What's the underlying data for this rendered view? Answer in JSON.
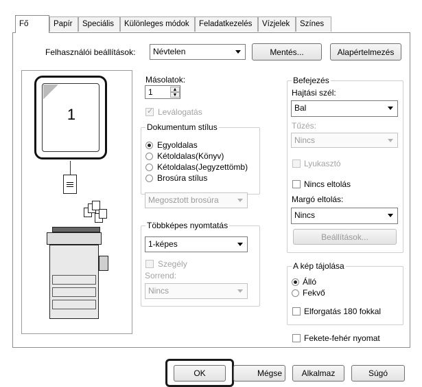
{
  "tabs": [
    "Fő",
    "Papír",
    "Speciális",
    "Különleges módok",
    "Feladatkezelés",
    "Vízjelek",
    "Színes"
  ],
  "user_settings": {
    "label": "Felhasználói beállítások:",
    "value": "Névtelen",
    "save_label": "Mentés...",
    "defaults_label": "Alapértelmezés"
  },
  "preview": {
    "page_number": "1"
  },
  "copies": {
    "label": "Másolatok:",
    "value": "1",
    "collate_label": "Leválogatás"
  },
  "document_style": {
    "title": "Dokumentum stílus",
    "options": [
      "Egyoldalas",
      "Kétoldalas(Könyv)",
      "Kétoldalas(Jegyzettömb)",
      "Brosúra stílus"
    ],
    "selected": "Egyoldalas",
    "split_booklet": "Megosztott brosúra"
  },
  "multipage": {
    "title": "Többképes nyomtatás",
    "value": "1-képes",
    "border_label": "Szegély",
    "order_label": "Sorrend:",
    "order_value": "Nincs"
  },
  "finishing": {
    "title": "Befejezés",
    "binding_edge_label": "Hajtási szél:",
    "binding_edge_value": "Bal",
    "staple_label": "Tűzés:",
    "staple_value": "Nincs",
    "punch_label": "Lyukasztó",
    "no_offset_label": "Nincs eltolás",
    "margin_shift_label": "Margó eltolás:",
    "margin_shift_value": "Nincs",
    "settings_button": "Beállítások..."
  },
  "orientation": {
    "title": "A kép tájolása",
    "portrait": "Álló",
    "landscape": "Fekvő",
    "selected": "Álló",
    "rotate_label": "Elforgatás 180 fokkal"
  },
  "bw_print_label": "Fekete-fehér nyomat",
  "buttons": {
    "ok": "OK",
    "cancel": "Mégse",
    "apply": "Alkalmaz",
    "help": "Súgó"
  }
}
